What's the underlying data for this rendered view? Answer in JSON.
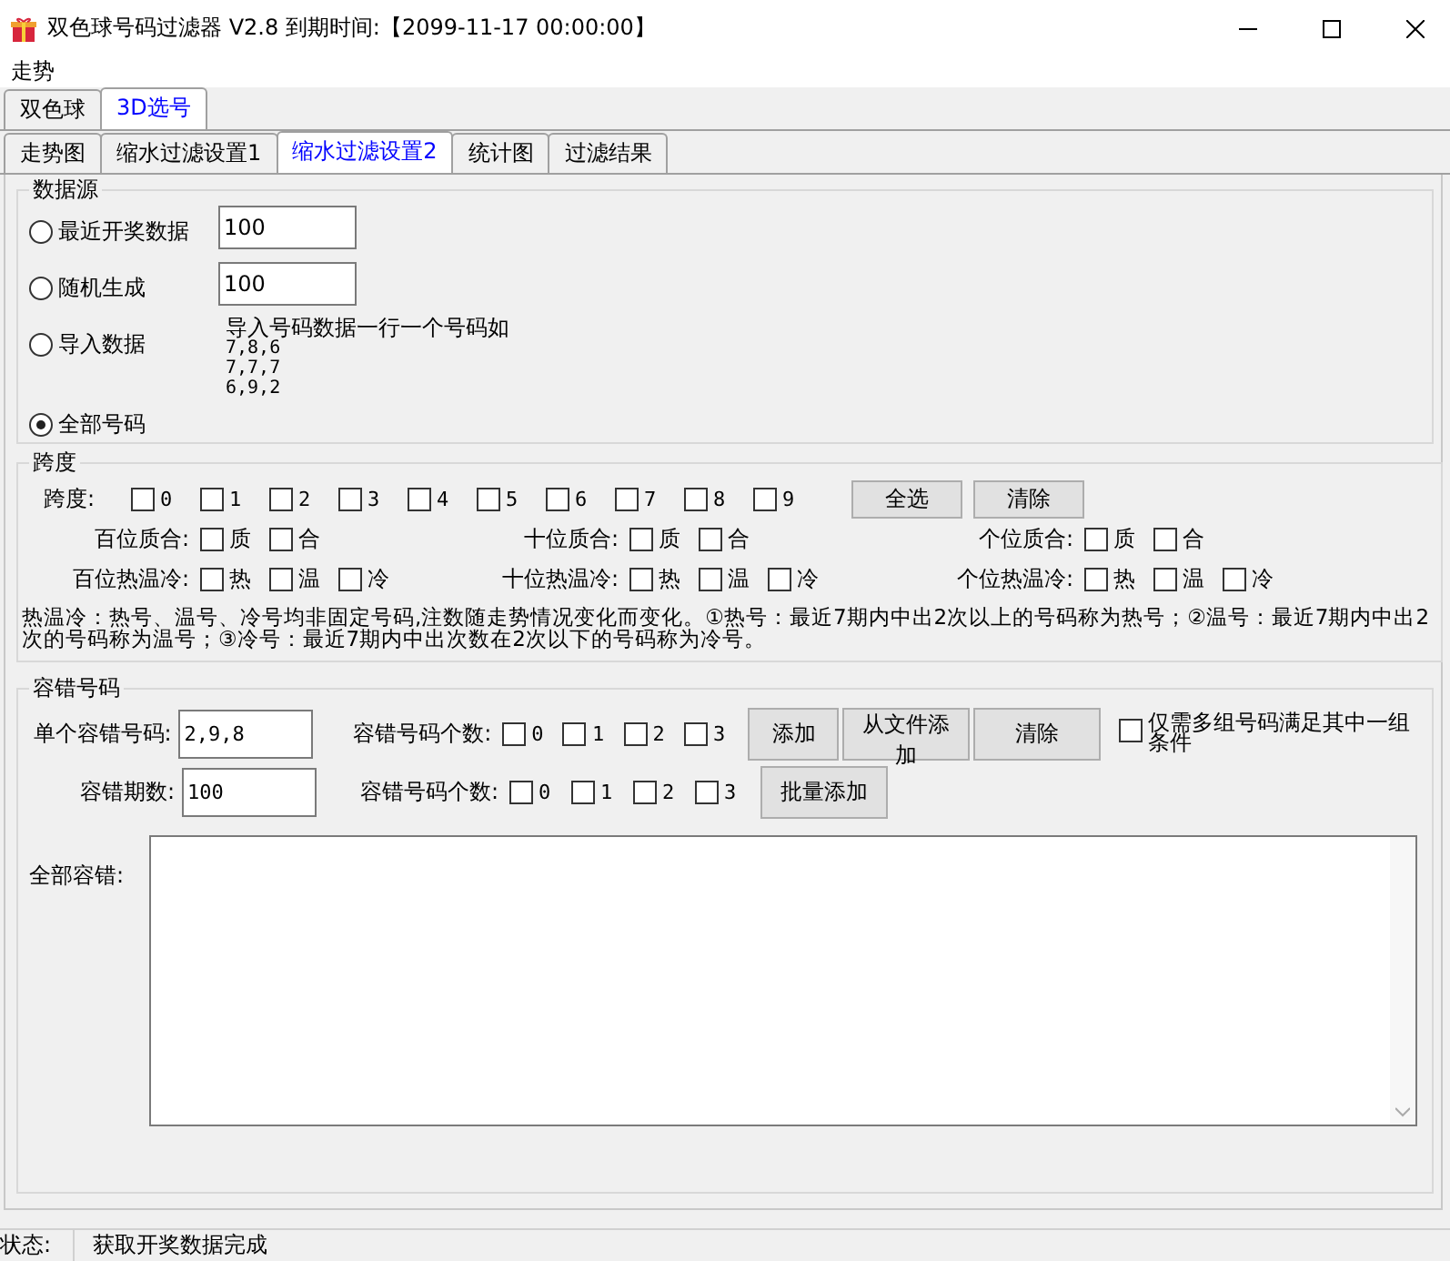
{
  "window": {
    "title": "双色球号码过滤器 V2.8 到期时间:【2099-11-17 00:00:00】"
  },
  "menu": [
    "走势"
  ],
  "lottery_tabs": [
    {
      "label": "双色球",
      "selected": false
    },
    {
      "label": "3D选号",
      "selected": true
    }
  ],
  "tabs": [
    {
      "label": "走势图",
      "selected": false
    },
    {
      "label": "缩水过滤设置1",
      "selected": false
    },
    {
      "label": "缩水过滤设置2",
      "selected": true
    },
    {
      "label": "统计图",
      "selected": false
    },
    {
      "label": "过滤结果",
      "selected": false
    }
  ],
  "data_source": {
    "title": "数据源",
    "options": [
      {
        "label": "最近开奖数据",
        "selected": false,
        "kind": "input",
        "value": "100"
      },
      {
        "label": "随机生成",
        "selected": false,
        "kind": "input",
        "value": "100"
      },
      {
        "label": "导入数据",
        "selected": false,
        "kind": "note",
        "note": "导入号码数据一行一个号码如",
        "examples": [
          "7,8,6",
          "7,7,7",
          "6,9,2"
        ]
      },
      {
        "label": "全部号码",
        "selected": true,
        "kind": "plain"
      }
    ]
  },
  "span": {
    "title": "跨度",
    "label": "跨度:",
    "digits": [
      {
        "label": "0",
        "checked": false
      },
      {
        "label": "1",
        "checked": false
      },
      {
        "label": "2",
        "checked": false
      },
      {
        "label": "3",
        "checked": false
      },
      {
        "label": "4",
        "checked": false
      },
      {
        "label": "5",
        "checked": false
      },
      {
        "label": "6",
        "checked": false
      },
      {
        "label": "7",
        "checked": false
      },
      {
        "label": "8",
        "checked": false
      },
      {
        "label": "9",
        "checked": false
      }
    ],
    "buttons": [
      "全选",
      "清除"
    ],
    "rows": [
      {
        "groups": [
          {
            "label": "百位质合:",
            "options": [
              {
                "label": "质",
                "checked": false
              },
              {
                "label": "合",
                "checked": false
              }
            ]
          },
          {
            "label": "十位质合:",
            "options": [
              {
                "label": "质",
                "checked": false
              },
              {
                "label": "合",
                "checked": false
              }
            ]
          },
          {
            "label": "个位质合:",
            "options": [
              {
                "label": "质",
                "checked": false
              },
              {
                "label": "合",
                "checked": false
              }
            ]
          }
        ]
      },
      {
        "groups": [
          {
            "label": "百位热温冷:",
            "options": [
              {
                "label": "热",
                "checked": false
              },
              {
                "label": "温",
                "checked": false
              },
              {
                "label": "冷",
                "checked": false
              }
            ]
          },
          {
            "label": "十位热温冷:",
            "options": [
              {
                "label": "热",
                "checked": false
              },
              {
                "label": "温",
                "checked": false
              },
              {
                "label": "冷",
                "checked": false
              }
            ]
          },
          {
            "label": "个位热温冷:",
            "options": [
              {
                "label": "热",
                "checked": false
              },
              {
                "label": "温",
                "checked": false
              },
              {
                "label": "冷",
                "checked": false
              }
            ]
          }
        ]
      }
    ],
    "note_lines": [
      "热温冷：热号、温号、冷号均非固定号码,注数随走势情况变化而变化。①热号：最近7期内中出2次以上的号码称为热号；②温号：最近7期内中出2",
      "次的号码称为温号；③冷号：最近7期内中出次数在2次以下的号码称为冷号。"
    ]
  },
  "tolerance": {
    "title": "容错号码",
    "rows": [
      {
        "label": "单个容错号码:",
        "value": "2,9,8",
        "count_label": "容错号码个数:",
        "counts": [
          {
            "label": "0",
            "checked": false
          },
          {
            "label": "1",
            "checked": false
          },
          {
            "label": "2",
            "checked": false
          },
          {
            "label": "3",
            "checked": false
          }
        ],
        "buttons": [
          "添加",
          "从文件添加",
          "清除"
        ],
        "option": {
          "label": "仅需多组号码满足其中一组条件",
          "checked": false
        }
      },
      {
        "label": "容错期数:",
        "value": "100",
        "count_label": "容错号码个数:",
        "counts": [
          {
            "label": "0",
            "checked": false
          },
          {
            "label": "1",
            "checked": false
          },
          {
            "label": "2",
            "checked": false
          },
          {
            "label": "3",
            "checked": false
          }
        ],
        "buttons": [
          "批量添加"
        ]
      }
    ],
    "all_label": "全部容错:"
  },
  "status_bar": {
    "label": "状态:",
    "text": "获取开奖数据完成"
  }
}
